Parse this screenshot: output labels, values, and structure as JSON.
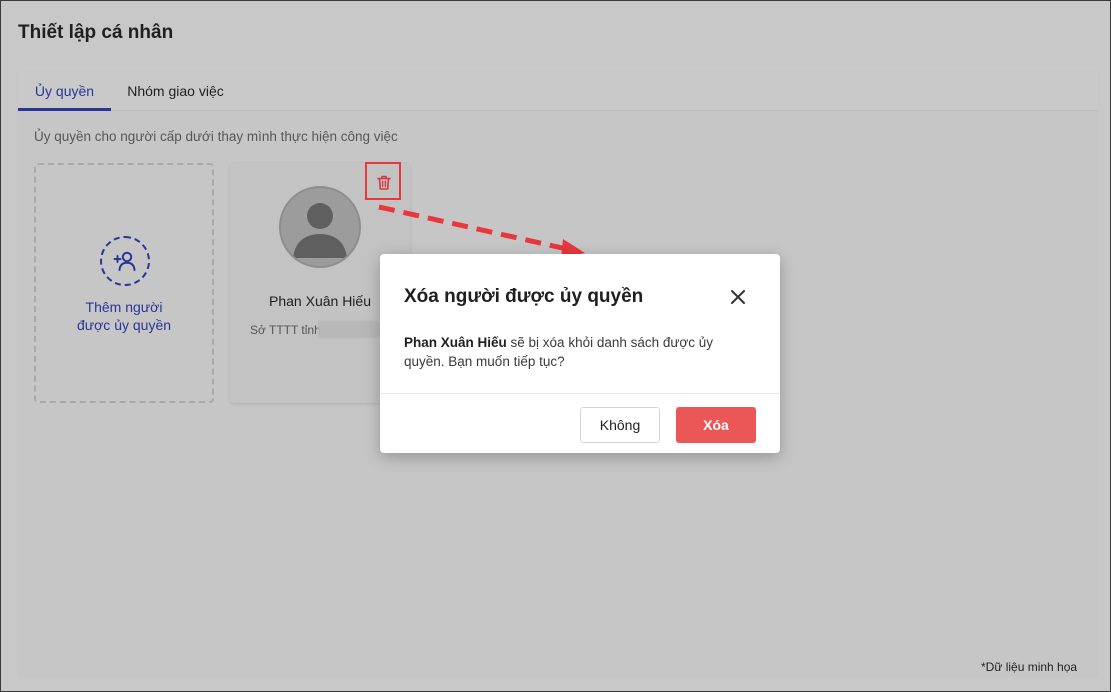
{
  "page": {
    "title": "Thiết lập cá nhân",
    "footnote": "*Dữ liệu minh họa"
  },
  "tabs": [
    {
      "label": "Ủy quyền",
      "active": true
    },
    {
      "label": "Nhóm giao việc",
      "active": false
    }
  ],
  "delegation": {
    "subtitle": "Ủy quyền cho người cấp dưới thay mình thực hiện công việc",
    "add_card": {
      "label_line1": "Thêm người",
      "label_line2": "được ủy quyền",
      "icon": "add-user-icon"
    },
    "delegates": [
      {
        "name": "Phan Xuân Hiếu",
        "org": "Sở TTTT tỉnh",
        "icon": "trash-icon"
      }
    ]
  },
  "dialog": {
    "title": "Xóa người được ủy quyền",
    "body_name": "Phan Xuân Hiếu",
    "body_text": " sẽ bị xóa khỏi danh sách được ủy quyền. Bạn muốn tiếp tục?",
    "cancel_label": "Không",
    "confirm_label": "Xóa",
    "close_icon": "close-icon"
  },
  "colors": {
    "accent": "#2b3596",
    "danger": "#eb5757",
    "highlight": "#e8383d"
  }
}
